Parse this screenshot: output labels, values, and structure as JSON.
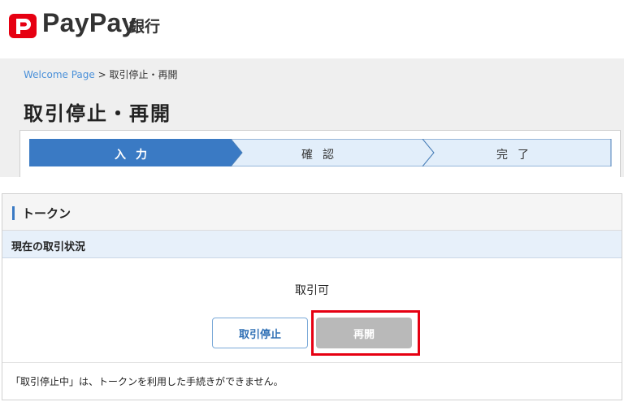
{
  "brand": {
    "name": "PayPay",
    "sub": "銀行",
    "color": "#e60012"
  },
  "breadcrumb": {
    "link": "Welcome Page",
    "separator": " > ",
    "current": "取引停止・再開"
  },
  "page_title": "取引停止・再開",
  "steps": [
    {
      "label": "入力",
      "active": true
    },
    {
      "label": "確認",
      "active": false
    },
    {
      "label": "完了",
      "active": false
    }
  ],
  "section": {
    "title": "トークン",
    "status_header": "現在の取引状況",
    "status_value": "取引可"
  },
  "buttons": {
    "suspend": "取引停止",
    "resume": "再開"
  },
  "note": "「取引停止中」は、トークンを利用した手続きができません。",
  "colors": {
    "accent": "#3a7ac4",
    "step_active": "#3a7ac4",
    "step_inactive": "#e2eefa",
    "highlight": "#e60012"
  }
}
